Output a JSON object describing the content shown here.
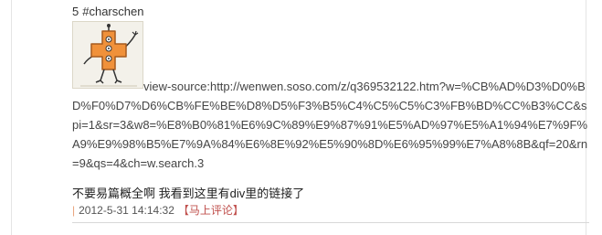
{
  "comment": {
    "index": "5",
    "author": "#charschen",
    "body_text": "view-source:http://wenwen.soso.com/z/q369532122.htm?w=%CB%AD%D3%D0%BD%F0%D7%D6%CB%FE%BE%D8%D5%F3%B5%C4%C5%C5%C3%FB%BD%CC%B3%CC&spi=1&sr=3&w8=%E8%B0%81%E6%9C%89%E9%87%91%E5%AD%97%E5%A1%94%E7%9F%A9%E9%98%B5%E7%9A%84%E6%8E%92%E5%90%8D%E6%95%99%E7%A8%8B&qf=20&rn=9&qs=4&ch=w.search.3",
    "message": "不要易篇概全啊  我看到这里有div里的链接了",
    "separator": "|",
    "timestamp": "2012-5-31 14:14:32",
    "reply_label": "【马上评论】",
    "avatar_icon": "cartoon-cross-creature-icon"
  },
  "colors": {
    "reply": "#c0504d",
    "pipe": "#e8a27a",
    "avatar_orange": "#f0913a"
  }
}
